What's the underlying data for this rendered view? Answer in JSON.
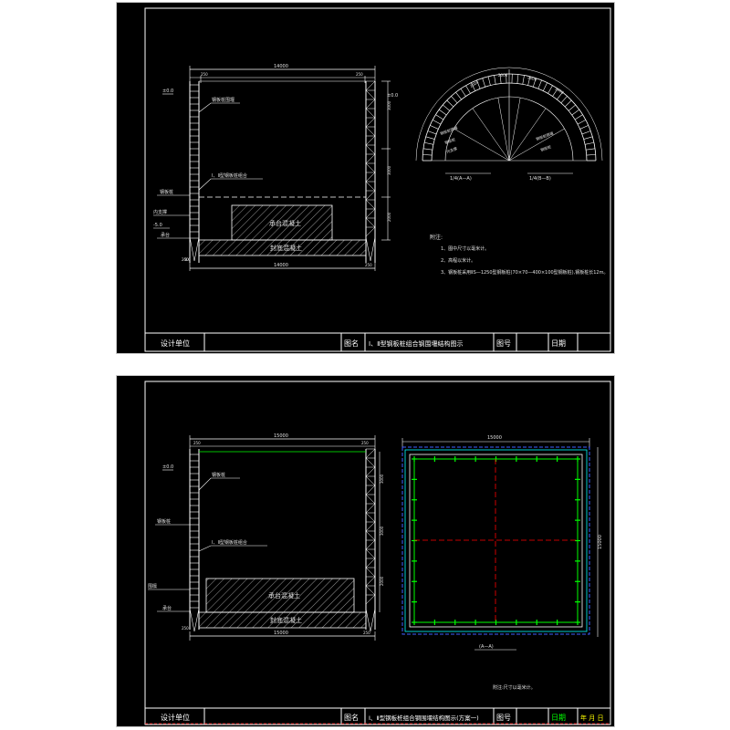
{
  "colors": {
    "background": "#000000",
    "line": "#ffffff",
    "frame": "#c8c8c8",
    "green": "#00ff00",
    "red": "#ff0000",
    "yellow": "#ffff00",
    "cyan": "#00ffff",
    "blue": "#4060ff",
    "magenta": "#ff40ff"
  },
  "sheet1": {
    "dims": {
      "total_top": "14000",
      "left_top": "250",
      "right_top": "250",
      "total_bottom": "14000",
      "left_bottom": "250",
      "right_bottom": "250",
      "h_upper": "3000",
      "h_mid": "3000",
      "h_lower": "2000"
    },
    "labels": {
      "level_top": "±0.0",
      "level_mid": "-5.0",
      "level_bottom": "-8.0",
      "tag_wall": "钢板桩",
      "tag_brace": "内支撑",
      "tag_cap": "承台",
      "leader_1": "钢板桩围堰",
      "leader_2": "Ⅰ、Ⅱ型钢板桩组合",
      "cap_text": "承台混凝土",
      "seal_text": "封底混凝土"
    },
    "arc": {
      "caption_left": "1/4(A—A)",
      "caption_right": "1/4(B—B)",
      "top_dims": [
        "2000",
        "2000",
        "2000",
        "2000"
      ],
      "labels": [
        "钢板桩围堰",
        "钢板桩",
        "内支撑",
        "钢板桩围堰",
        "钢板桩"
      ]
    },
    "notes": {
      "title": "附注:",
      "items": [
        "1、图中尺寸以毫米计。",
        "2、高程以米计。",
        "3、钢板桩采用ⅡS—1250型钢板桩(70×70—400×100型钢板桩),钢板桩长12m。"
      ]
    },
    "title_block": {
      "unit_label": "设计单位",
      "drawing_label": "图名",
      "drawing_name": "Ⅰ、Ⅱ型钢板桩组合钢围堰结构图示",
      "number_label": "图号",
      "date_label": "日期",
      "date_value": ""
    }
  },
  "sheet2": {
    "dims": {
      "total_top": "15000",
      "left_top": "250",
      "right_top": "250",
      "total_bottom": "15000",
      "left_bottom": "250",
      "right_bottom": "250",
      "h_upper": "3000",
      "h_mid": "3000",
      "h_lower": "2000"
    },
    "labels": {
      "level_top": "±0.0",
      "tag_wall": "钢板桩",
      "tag_brace": "围檩",
      "tag_cap": "承台",
      "leader_1": "钢板桩",
      "leader_2": "Ⅰ、Ⅱ型钢板桩组合",
      "cap_text": "承台混凝土",
      "seal_text": "封底混凝土"
    },
    "plan": {
      "top_dim": "15000",
      "right_dim": "15000",
      "caption": "(A—A)"
    },
    "notes": {
      "text": "附注:尺寸以毫米计。"
    },
    "title_block": {
      "unit_label": "设计单位",
      "drawing_label": "图名",
      "drawing_name": "Ⅰ、Ⅱ型钢板桩组合钢围堰结构图示(方案一)",
      "number_label": "图号",
      "date_label": "日期",
      "date_value": "年 月 日"
    }
  }
}
